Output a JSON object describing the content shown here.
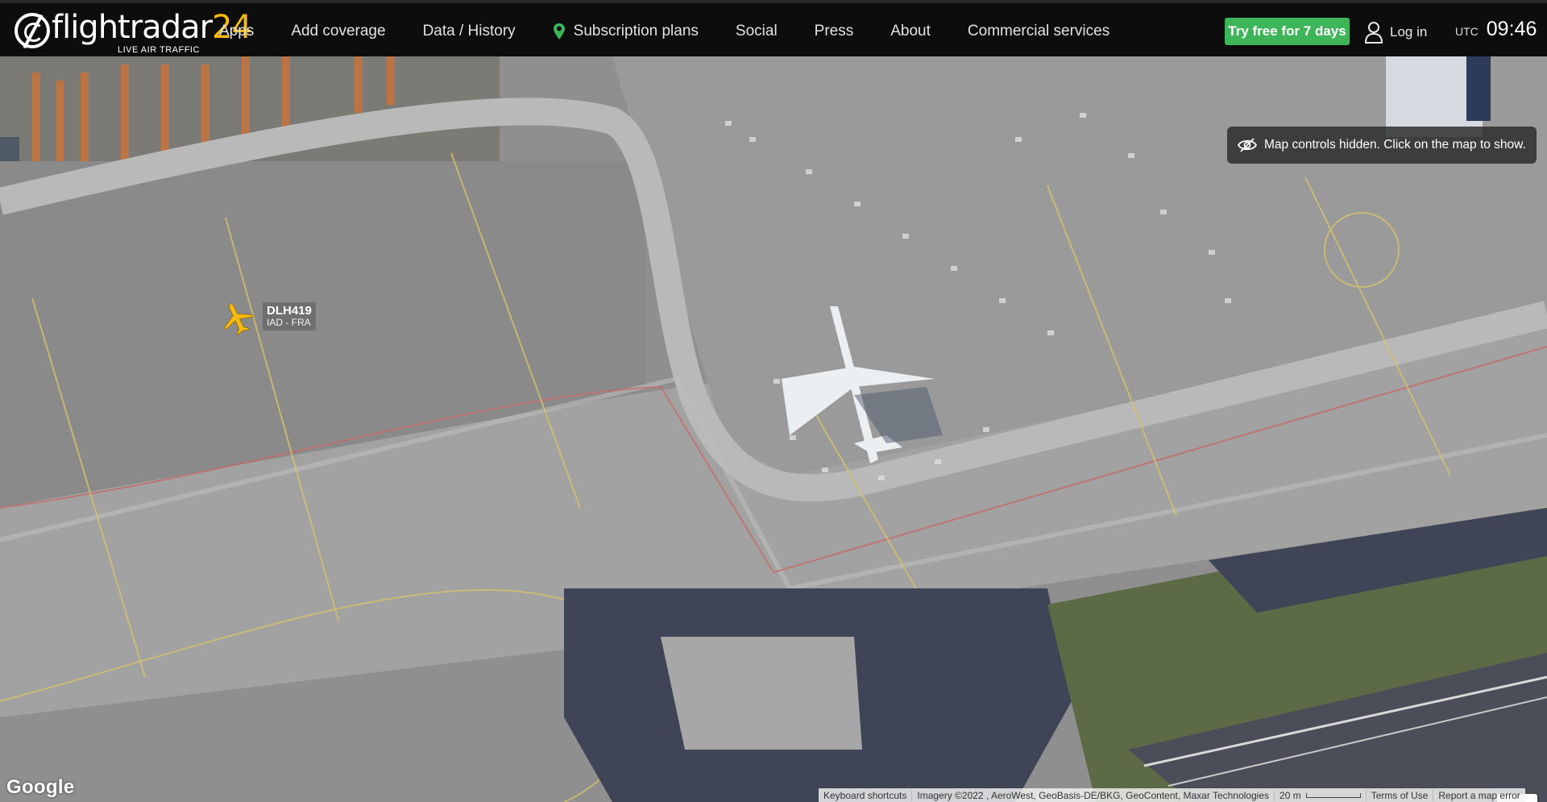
{
  "brand": {
    "name_word": "flightradar",
    "name_num": "24",
    "tagline": "LIVE AIR TRAFFIC"
  },
  "nav": {
    "items": [
      {
        "label": "Apps"
      },
      {
        "label": "Add coverage"
      },
      {
        "label": "Data / History"
      },
      {
        "label": "Subscription plans",
        "icon": "pin-icon",
        "icon_color": "#3fb55a"
      },
      {
        "label": "Social"
      },
      {
        "label": "Press"
      },
      {
        "label": "About"
      },
      {
        "label": "Commercial services"
      }
    ]
  },
  "header": {
    "trial_button": "Try free for 7 days",
    "trial_color": "#3fb55a",
    "login_label": "Log in",
    "login_icon": "user-icon",
    "clock_tz": "UTC",
    "clock_time": "09:46"
  },
  "map": {
    "notice": "Map controls hidden. Click on the map to show.",
    "notice_icon": "eye-slash-icon",
    "flight": {
      "callsign": "DLH419",
      "route": "IAD - FRA",
      "icon": "plane-icon",
      "icon_color": "#f5b90f"
    },
    "google_logo": "Google",
    "layers_icon": "grid-icon",
    "attribution": {
      "shortcuts": "Keyboard shortcuts",
      "imagery": "Imagery ©2022 , AeroWest, GeoBasis-DE/BKG, GeoContent, Maxar Technologies",
      "scale": "20 m",
      "terms": "Terms of Use",
      "report": "Report a map error"
    }
  }
}
